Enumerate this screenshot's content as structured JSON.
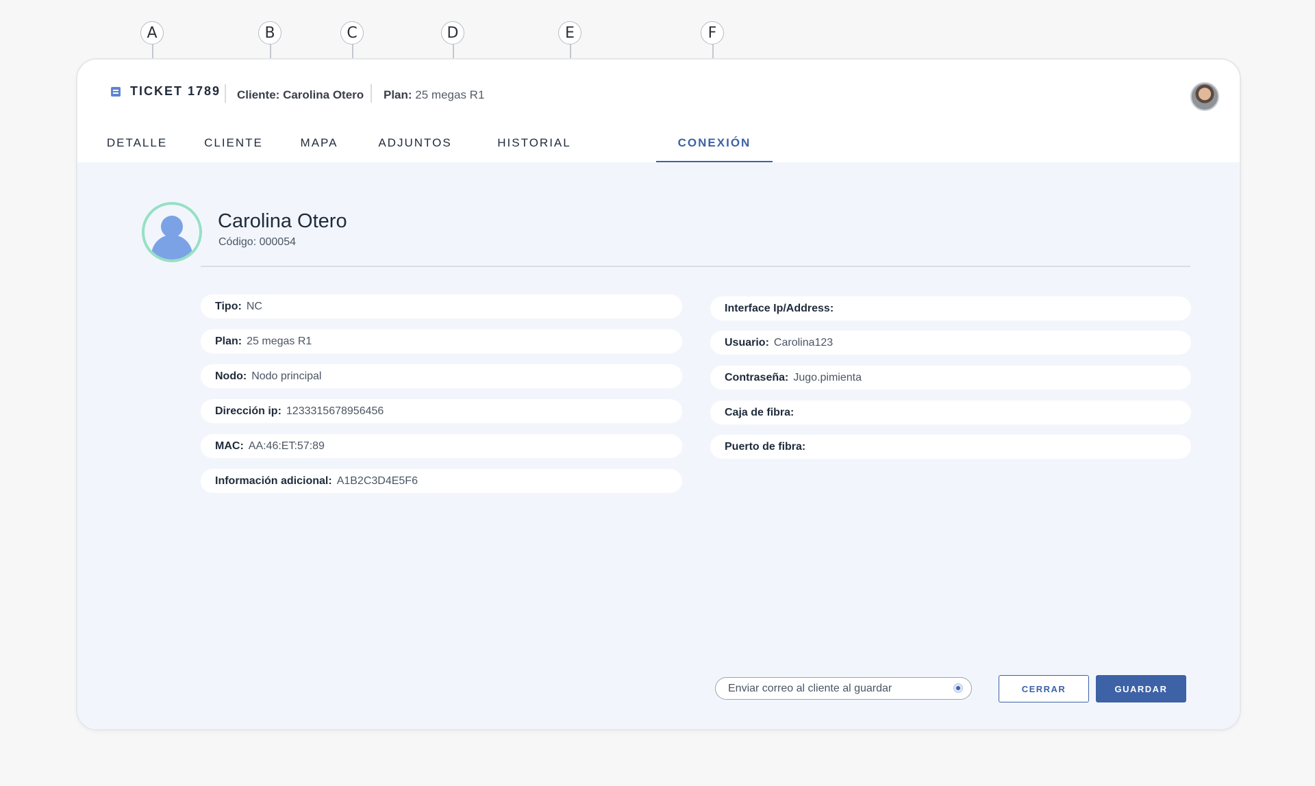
{
  "callouts": [
    "A",
    "B",
    "C",
    "D",
    "E",
    "F"
  ],
  "header": {
    "ticket_title": "TICKET 1789",
    "client_label": "Cliente:",
    "client_value": "Carolina Otero",
    "plan_label": "Plan:",
    "plan_value": "25 megas R1",
    "avatar_icon": "user-avatar-photo"
  },
  "tabs": [
    {
      "label": "DETALLE",
      "active": false
    },
    {
      "label": "CLIENTE",
      "active": false
    },
    {
      "label": "MAPA",
      "active": false
    },
    {
      "label": "ADJUNTOS",
      "active": false
    },
    {
      "label": "HISTORIAL",
      "active": false
    },
    {
      "label": "CONEXIÓN",
      "active": true
    }
  ],
  "customer": {
    "name": "Carolina Otero",
    "code": "Código: 000054",
    "icon": "user-profile-icon"
  },
  "fields_left": [
    {
      "label": "Tipo:",
      "value": "NC"
    },
    {
      "label": "Plan:",
      "value": "25 megas R1"
    },
    {
      "label": "Nodo:",
      "value": "Nodo principal"
    },
    {
      "label": "Dirección ip:",
      "value": "1233315678956456"
    },
    {
      "label": "MAC:",
      "value": "AA:46:ET:57:89"
    },
    {
      "label": "Información adicional:",
      "value": "A1B2C3D4E5F6"
    }
  ],
  "fields_right": [
    {
      "label": "Interface Ip/Address:",
      "value": ""
    },
    {
      "label": "Usuario:",
      "value": "Carolina123"
    },
    {
      "label": "Contraseña:",
      "value": "Jugo.pimienta"
    },
    {
      "label": "Caja de fibra:",
      "value": ""
    },
    {
      "label": "Puerto de fibra:",
      "value": ""
    }
  ],
  "footer": {
    "email_toggle_label": "Enviar correo al cliente al guardar",
    "email_toggle_on": true,
    "close_button": "CERRAR",
    "save_button": "GUARDAR"
  },
  "colors": {
    "accent": "#3d62a6",
    "profile_ring": "#96e0c4",
    "content_bg": "#f2f6fc"
  }
}
